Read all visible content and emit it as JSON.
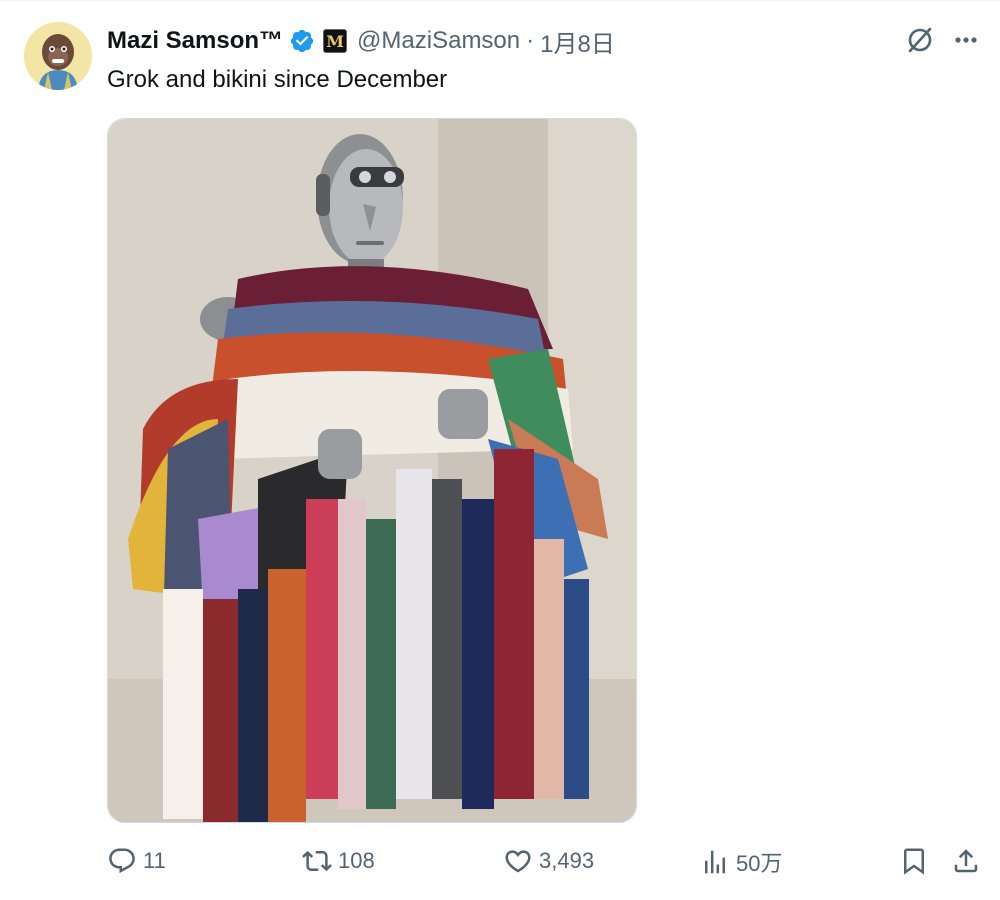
{
  "tweet": {
    "author": {
      "display_name": "Mazi Samson™",
      "handle": "@MaziSamson",
      "verified_icon": "verified-badge-icon",
      "affiliate_badge": "M"
    },
    "separator": "·",
    "timestamp": "1月8日",
    "text": "Grok and bikini since December",
    "media": {
      "kind": "photo",
      "description_icon": "robot-with-clothes-photo"
    },
    "header_icons": [
      "grok-icon",
      "more-icon"
    ],
    "actions": {
      "reply_count": "11",
      "retweet_count": "108",
      "like_count": "3,493",
      "view_count": "50万"
    }
  },
  "colors": {
    "text_primary": "#0f1419",
    "text_secondary": "#536471",
    "verified_blue": "#1d9bf0",
    "border": "#cfd9de"
  }
}
